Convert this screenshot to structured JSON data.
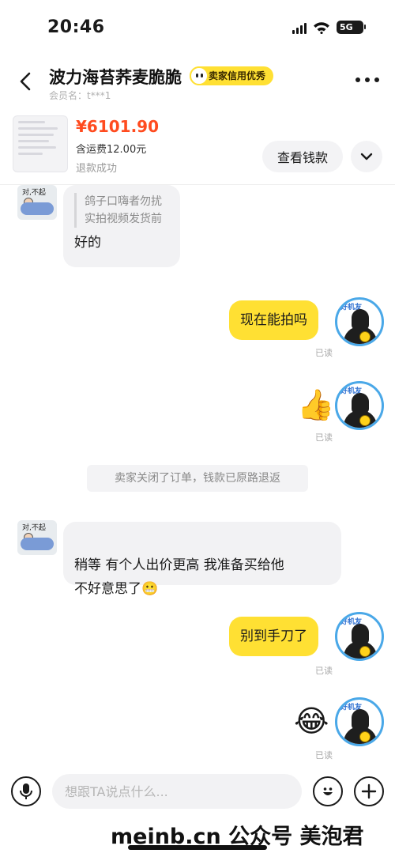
{
  "status_bar": {
    "time": "20:46",
    "network": "5G"
  },
  "header": {
    "title": "波力海苔荞麦脆脆",
    "badge": "卖家信用优秀",
    "member": "会员名：t***1"
  },
  "order": {
    "price": "¥6101.90",
    "shipping": "含运费12.00元",
    "status": "退款成功",
    "view_button": "查看钱款"
  },
  "messages": [
    {
      "side": "left",
      "quote": "鸽子口嗨者勿扰\n实拍视频发货前",
      "text": "好的"
    },
    {
      "side": "right",
      "text": "现在能拍吗",
      "read": "已读"
    },
    {
      "side": "right",
      "sticker": "👍🌸",
      "read": "已读"
    },
    {
      "side": "system",
      "text": "卖家关闭了订单，钱款已原路退返"
    },
    {
      "side": "left",
      "text": "稍等 有个人出价更高 我准备买给他\n不好意思了😬"
    },
    {
      "side": "right",
      "text": "别到手刀了",
      "read": "已读"
    },
    {
      "side": "right",
      "sticker": "😂",
      "read": "已读"
    }
  ],
  "avatars": {
    "left_caption": "对,不起",
    "right_caption": "好机友"
  },
  "input": {
    "placeholder": "想跟TA说点什么..."
  },
  "footer": {
    "watermark": "meinb.cn 公众号 美泡君"
  }
}
